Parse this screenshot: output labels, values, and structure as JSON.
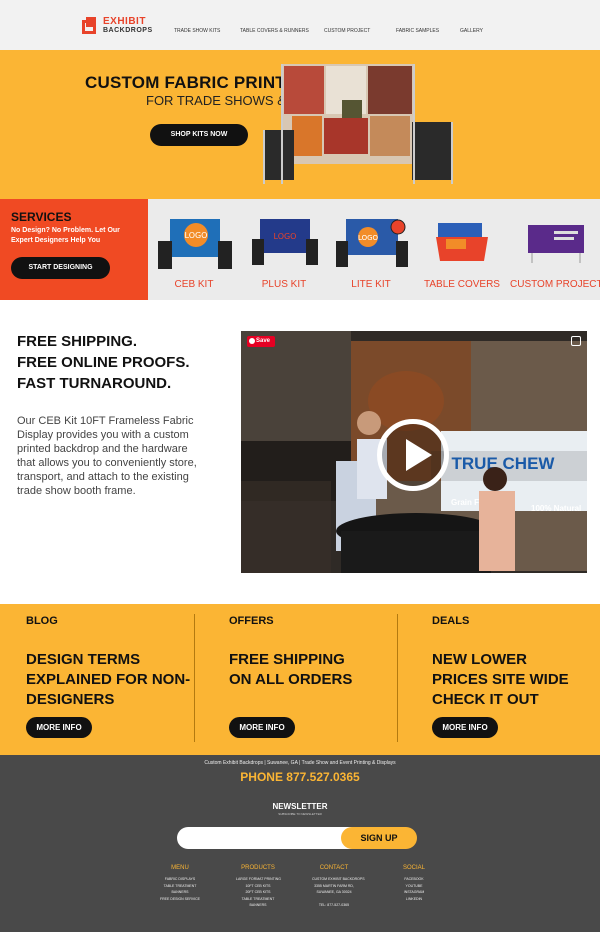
{
  "brand": {
    "line1": "EXHIBIT",
    "line2": "BACKDROPS"
  },
  "nav": [
    "TRADE SHOW KITS",
    "TABLE COVERS & RUNNERS",
    "CUSTOM PROJECT",
    "FABRIC SAMPLES",
    "GALLERY"
  ],
  "hero": {
    "title": "CUSTOM FABRIC PRINTS",
    "subtitle": "FOR TRADE SHOWS & EVENTS",
    "button": "SHOP KITS NOW"
  },
  "services": {
    "title": "SERVICES",
    "subtitle": "No Design? No Problem. Let Our Expert Designers Help You",
    "button": "START DESIGNING"
  },
  "products": [
    {
      "label": "CEB KIT",
      "img_text": "LOGO"
    },
    {
      "label": "PLUS KIT",
      "img_text": "LOGO"
    },
    {
      "label": "LITE KIT",
      "img_text": "LOGO"
    },
    {
      "label": "TABLE COVERS",
      "img_text": ""
    },
    {
      "label": "CUSTOM PROJECTS",
      "img_text": ""
    }
  ],
  "features": {
    "line1": "FREE SHIPPING.",
    "line2": "FREE ONLINE PROOFS.",
    "line3": "FAST TURNAROUND."
  },
  "description": "Our CEB Kit 10FT Frameless Fabric Display provides you with a custom printed backdrop and the hardware that allows you to conveniently store, transport, and attach to the existing trade show booth frame.",
  "video": {
    "save_label": "Save",
    "banner_text": "TRUE CHEW",
    "banner_sub1": "Grain Free",
    "banner_sub2": "100% Natural"
  },
  "promos": [
    {
      "tag": "BLOG",
      "headline": "DESIGN TERMS EXPLAINED FOR NON-DESIGNERS",
      "button": "MORE INFO"
    },
    {
      "tag": "OFFERS",
      "headline": "FREE SHIPPING ON ALL ORDERS",
      "button": "MORE INFO"
    },
    {
      "tag": "DEALS",
      "headline": "NEW LOWER PRICES SITE WIDE CHECK IT OUT",
      "button": "MORE INFO"
    }
  ],
  "footer": {
    "tagline": "Custom Exhibit Backdrops | Suwanee, GA | Trade Show and Event Printing & Displays",
    "phone": "PHONE  877.527.0365",
    "newsletter": "NEWSLETTER",
    "newsletter_sub": "SUBSCRIBE TO NEWSLETTER",
    "signup": "SIGN UP",
    "columns": [
      {
        "heading": "MENU",
        "items": [
          "FABRIC DISPLAYS",
          "TABLE TREATMENT",
          "BANNERS",
          "FREE DESIGN SERVICE"
        ]
      },
      {
        "heading": "PRODUCTS",
        "items": [
          "LARGE FORMAT PRINTING",
          "10FT CEB KITS",
          "20FT CEB KITS",
          "TABLE TREATMENT",
          "BANNERS"
        ]
      },
      {
        "heading": "CONTACT",
        "items": [
          "CUSTOM EXHIBIT BACKDROPS",
          "3355 MARTIN FARM RD,",
          "SUWANEE, GA 30024",
          "",
          "TEL: 877-527-0365"
        ]
      },
      {
        "heading": "SOCIAL",
        "items": [
          "FACEBOOK",
          "YOUTUBE",
          "INSTAGRAM",
          "LINKEDIN"
        ]
      }
    ]
  },
  "colors": {
    "accent": "#fbb534",
    "brand_red": "#e8432a",
    "services_bg": "#f04a23",
    "footer_bg": "#494949"
  }
}
